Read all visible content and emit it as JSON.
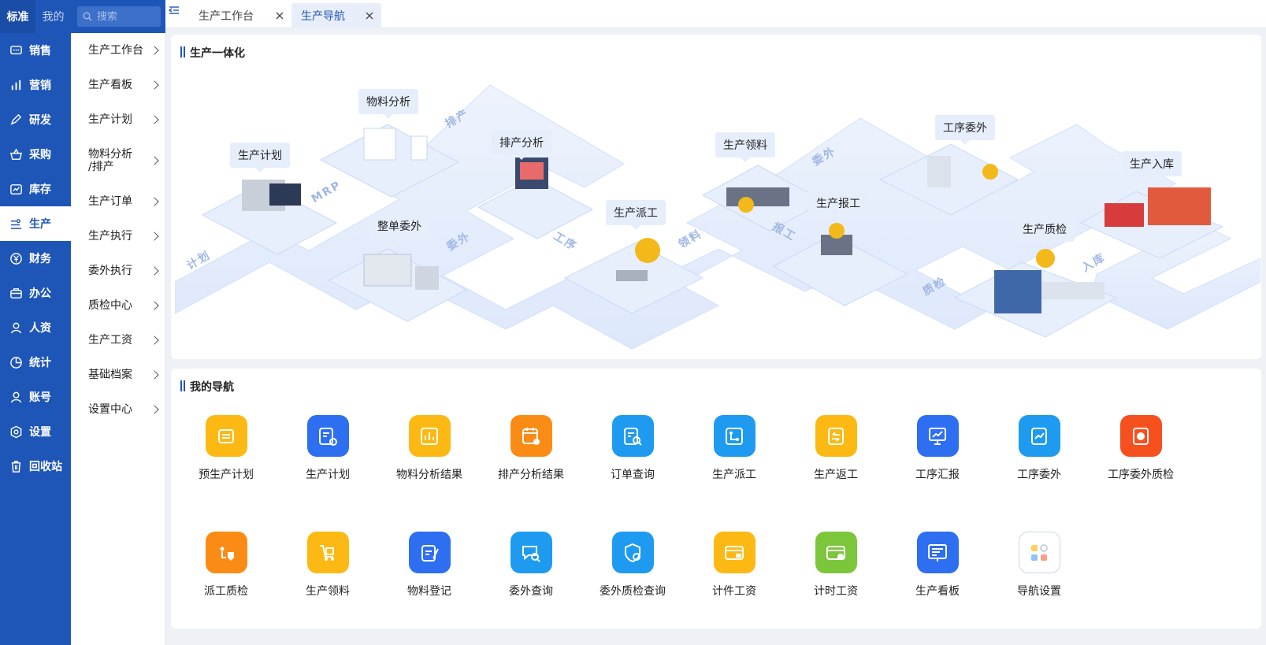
{
  "rail": {
    "tab_standard": "标准",
    "tab_mine": "我的",
    "items": [
      {
        "label": "销售",
        "icon": "chat-icon"
      },
      {
        "label": "营销",
        "icon": "bar-chart-icon"
      },
      {
        "label": "研发",
        "icon": "pen-icon"
      },
      {
        "label": "采购",
        "icon": "basket-icon"
      },
      {
        "label": "库存",
        "icon": "inventory-icon"
      },
      {
        "label": "生产",
        "icon": "production-icon"
      },
      {
        "label": "财务",
        "icon": "yen-icon"
      },
      {
        "label": "办公",
        "icon": "briefcase-icon"
      },
      {
        "label": "人资",
        "icon": "person-icon"
      },
      {
        "label": "统计",
        "icon": "pie-icon"
      },
      {
        "label": "账号",
        "icon": "account-icon"
      },
      {
        "label": "设置",
        "icon": "gear-icon"
      },
      {
        "label": "回收站",
        "icon": "trash-icon"
      }
    ]
  },
  "search": {
    "placeholder": "搜索"
  },
  "submenu": [
    "生产工作台",
    "生产看板",
    "生产计划",
    "物料分析\n/排产",
    "生产订单",
    "生产执行",
    "委外执行",
    "质检中心",
    "生产工资",
    "基础档案",
    "设置中心"
  ],
  "tabs": [
    {
      "label": "生产工作台"
    },
    {
      "label": "生产导航"
    }
  ],
  "flow_card": {
    "title": "生产一体化",
    "nodes": [
      "物料分析",
      "排产分析",
      "生产计划",
      "整单委外",
      "生产派工",
      "生产领料",
      "生产报工",
      "工序委外",
      "生产质检",
      "生产入库"
    ],
    "road_labels": [
      "计划",
      "MRP",
      "排产",
      "委外",
      "工序",
      "领料",
      "报工",
      "委外",
      "质检",
      "入库"
    ]
  },
  "nav_card": {
    "title": "我的导航",
    "items": [
      {
        "label": "预生产计划",
        "color": "#fdb913",
        "icon": "plan-icon"
      },
      {
        "label": "生产计划",
        "color": "#2d6ff0",
        "icon": "plan-gear-icon"
      },
      {
        "label": "物料分析结果",
        "color": "#fdb913",
        "icon": "chart-icon"
      },
      {
        "label": "排产分析结果",
        "color": "#fa8c16",
        "icon": "calendar-chart-icon"
      },
      {
        "label": "订单查询",
        "color": "#1e9bf0",
        "icon": "order-search-icon"
      },
      {
        "label": "生产派工",
        "color": "#1e9bf0",
        "icon": "dispatch-icon"
      },
      {
        "label": "生产返工",
        "color": "#fdb913",
        "icon": "rework-icon"
      },
      {
        "label": "工序汇报",
        "color": "#2d6ff0",
        "icon": "report-icon"
      },
      {
        "label": "工序委外",
        "color": "#1e9bf0",
        "icon": "outsource-icon"
      },
      {
        "label": "工序委外质检",
        "color": "#f5501e",
        "icon": "quality-icon"
      },
      {
        "label": "派工质检",
        "color": "#fa8c16",
        "icon": "dispatch-quality-icon"
      },
      {
        "label": "生产领料",
        "color": "#fdb913",
        "icon": "cart-icon"
      },
      {
        "label": "物料登记",
        "color": "#2d6ff0",
        "icon": "register-icon"
      },
      {
        "label": "委外查询",
        "color": "#1e9bf0",
        "icon": "outsource-search-icon"
      },
      {
        "label": "委外质检查询",
        "color": "#1e9bf0",
        "icon": "quality-search-icon"
      },
      {
        "label": "计件工资",
        "color": "#fdb913",
        "icon": "piece-wage-icon"
      },
      {
        "label": "计时工资",
        "color": "#7cc63c",
        "icon": "time-wage-icon"
      },
      {
        "label": "生产看板",
        "color": "#2d6ff0",
        "icon": "board-icon"
      },
      {
        "label": "导航设置",
        "color": "#ffffff",
        "icon": "nav-settings-icon"
      }
    ]
  }
}
